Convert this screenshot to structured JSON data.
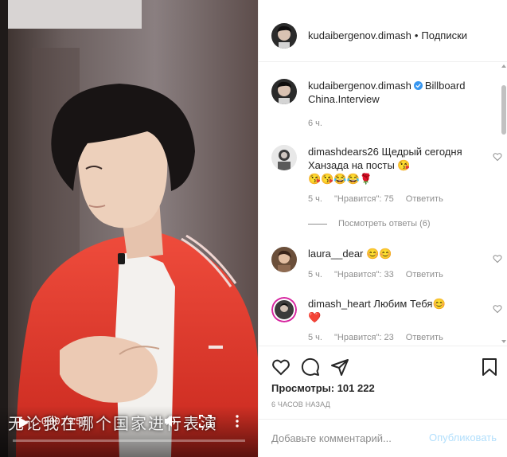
{
  "video": {
    "time": "0:00 / 9:57",
    "subtitles": "无论我在哪个国家进行表演",
    "progress": 0
  },
  "header": {
    "username": "kudaibergenov.dimash",
    "separator": "•",
    "follow_label": "Подписки"
  },
  "caption": {
    "username": "kudaibergenov.dimash",
    "text": "Billboard China.Interview",
    "time": "6 ч."
  },
  "comments": [
    {
      "username": "dimashdears26",
      "text": "Щедрый сегодня Ханзада на посты 😘",
      "emoji_line": "😘😘😂😂🌹",
      "time": "5 ч.",
      "likes": "\"Нравится\": 75",
      "reply": "Ответить"
    },
    {
      "username": "laura__dear",
      "text": "😊😊",
      "time": "5 ч.",
      "likes": "\"Нравится\": 33",
      "reply": "Ответить"
    },
    {
      "username": "dimash_heart",
      "text": "Любим Тебя😊",
      "emoji_line": "❤️",
      "time": "5 ч.",
      "likes": "\"Нравится\": 23",
      "reply": "Ответить"
    }
  ],
  "view_replies": "Посмотреть ответы (6)",
  "stats": {
    "views": "Просмотры: 101 222",
    "posted": "6 ЧАСОВ НАЗАД"
  },
  "compose": {
    "placeholder": "Добавьте комментарий...",
    "publish_label": "Опубликовать"
  },
  "colors": {
    "accent": "#0095f6",
    "publish_disabled": "#b2dffc",
    "jacket": "#e8382a"
  },
  "icons": [
    "heart-icon",
    "comment-icon",
    "share-icon",
    "bookmark-icon",
    "play-icon",
    "volume-icon",
    "fullscreen-icon",
    "more-icon"
  ]
}
